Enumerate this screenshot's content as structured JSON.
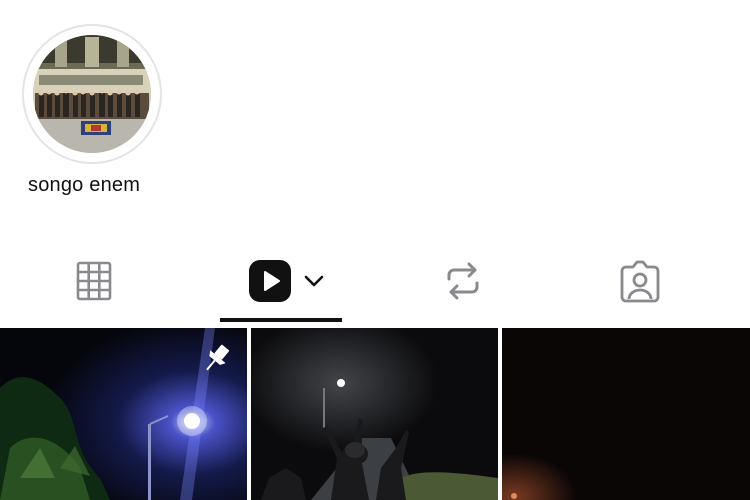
{
  "highlight": {
    "label": "songo enem"
  },
  "tabs": [
    {
      "name": "posts",
      "icon": "grid-icon",
      "selected": false
    },
    {
      "name": "reels",
      "icon": "reels-play-icon",
      "selected": true,
      "has_dropdown": true
    },
    {
      "name": "reposts",
      "icon": "repost-icon",
      "selected": false
    },
    {
      "name": "tagged",
      "icon": "tagged-person-icon",
      "selected": false
    }
  ],
  "grid": {
    "items": [
      {
        "type": "reel",
        "pinned": true,
        "icon": "pin-icon"
      },
      {
        "type": "reel",
        "pinned": false
      },
      {
        "type": "reel",
        "pinned": false
      }
    ]
  },
  "colors": {
    "text": "#111111",
    "icon_inactive": "#8a8a8e",
    "ring": "#e4e4e7",
    "indicator": "#111111"
  }
}
